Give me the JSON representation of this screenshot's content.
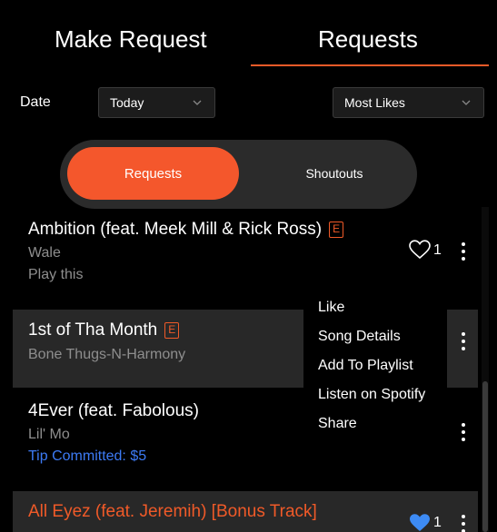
{
  "tabs": {
    "make_request": "Make Request",
    "requests": "Requests"
  },
  "filters": {
    "date_label": "Date",
    "date_value": "Today",
    "sort_value": "Most Likes"
  },
  "toggle": {
    "requests": "Requests",
    "shoutouts": "Shoutouts"
  },
  "songs": [
    {
      "title": "Ambition (feat. Meek Mill & Rick Ross)",
      "explicit": "E",
      "artist": "Wale",
      "note": "Play this",
      "likes": "1"
    },
    {
      "title": "1st of Tha Month",
      "explicit": "E",
      "artist": "Bone Thugs-N-Harmony"
    },
    {
      "title": "4Ever (feat. Fabolous)",
      "artist": "Lil' Mo",
      "note": "Tip Committed: $5"
    },
    {
      "title": "All Eyez (feat. Jeremih) [Bonus Track]",
      "likes": "1"
    }
  ],
  "menu": [
    "Like",
    "Song Details",
    "Add To Playlist",
    "Listen on Spotify",
    "Share"
  ],
  "colors": {
    "accent": "#f05a28",
    "tip": "#3d7bf5",
    "liked": "#3d8bf5"
  }
}
